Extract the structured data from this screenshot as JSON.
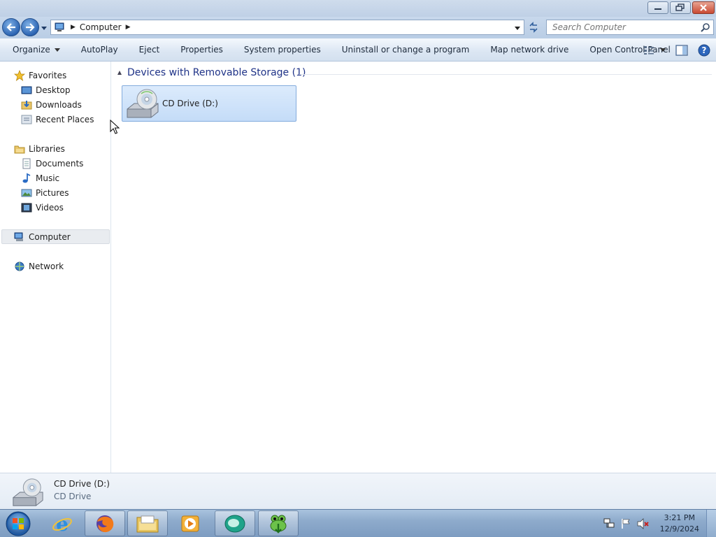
{
  "window": {
    "controls": [
      "minimize",
      "restore",
      "close"
    ]
  },
  "address_bar": {
    "crumbs": [
      "Computer"
    ],
    "search_placeholder": "Search Computer"
  },
  "command_bar": {
    "organize": "Organize",
    "items": [
      "AutoPlay",
      "Eject",
      "Properties",
      "System properties",
      "Uninstall or change a program",
      "Map network drive",
      "Open Control Panel"
    ]
  },
  "nav_pane": {
    "favorites": {
      "label": "Favorites",
      "items": [
        "Desktop",
        "Downloads",
        "Recent Places"
      ]
    },
    "libraries": {
      "label": "Libraries",
      "items": [
        "Documents",
        "Music",
        "Pictures",
        "Videos"
      ]
    },
    "computer": "Computer",
    "network": "Network"
  },
  "content": {
    "group_title": "Devices with Removable Storage (1)",
    "drives": [
      {
        "label": "CD Drive (D:)"
      }
    ]
  },
  "details": {
    "name": "CD Drive (D:)",
    "type": "CD Drive"
  },
  "taskbar": {
    "pinned": [
      "internet-explorer",
      "firefox",
      "windows-explorer",
      "media-player",
      "app-green",
      "frog-downloader"
    ],
    "time": "3:21 PM",
    "date": "12/9/2024"
  },
  "colors": {
    "accent_blue": "#1e3287",
    "selection": "#c4dcf8",
    "taskbar": "#8eabcc"
  }
}
